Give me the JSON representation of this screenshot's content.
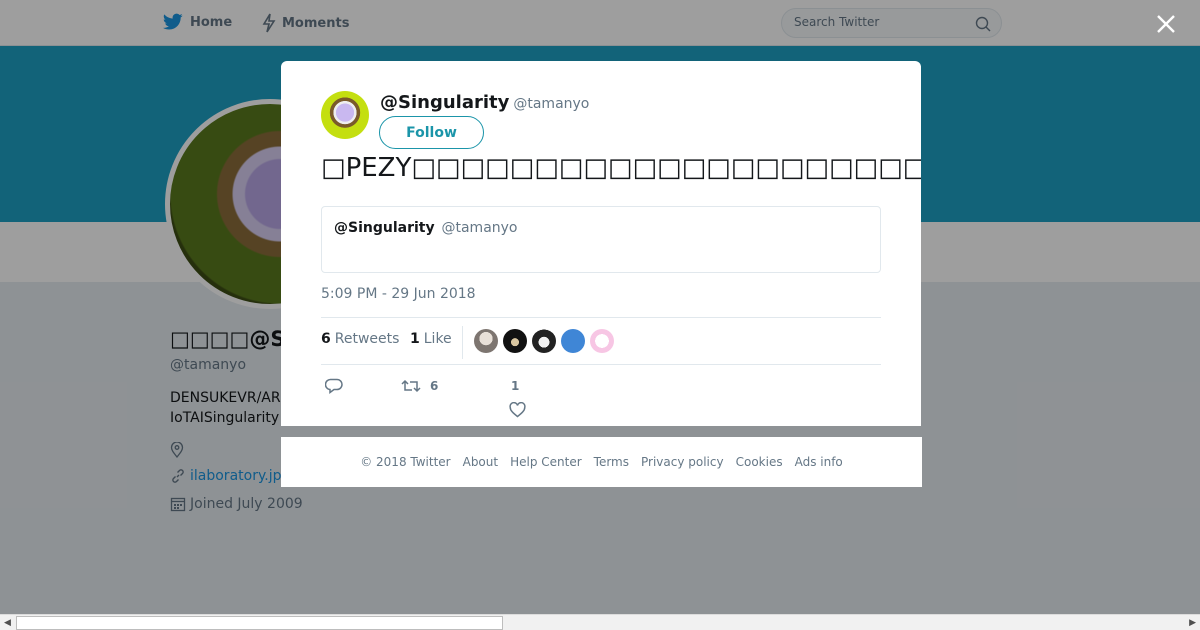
{
  "nav": {
    "home_label": "Home",
    "moments_label": "Moments",
    "search_placeholder": "Search Twitter"
  },
  "profile": {
    "name": "□□□□@Singularity",
    "handle": "@tamanyo",
    "bio": "DENSUKEVR/AR IoTAISingularity",
    "url": "ilaboratory.jp",
    "joined": "Joined July 2009"
  },
  "tweet": {
    "display_name": "@Singularity",
    "handle": "@tamanyo",
    "follow_label": "Follow",
    "text": "□PEZY□□□□□□□□□□□□□□□□□□□□□□□□□□□□□□□□□□□□□□□□□□□□□□□□□□□□",
    "quote_name": "@Singularity",
    "quote_handle": "@tamanyo",
    "timestamp": "5:09 PM - 29 Jun 2018",
    "retweets_count": "6",
    "retweets_label": "Retweets",
    "likes_count": "1",
    "likes_label": "Like",
    "action_retweet_count": "6",
    "action_like_count": "1"
  },
  "footer": {
    "copyright": "© 2018 Twitter",
    "links": [
      "About",
      "Help Center",
      "Terms",
      "Privacy policy",
      "Cookies",
      "Ads info"
    ]
  },
  "colors": {
    "banner": "#1da1c4",
    "accent": "#1b95e0",
    "follow": "#1b95a9"
  },
  "icons": [
    "twitter-bird-icon",
    "lightning-icon",
    "search-icon",
    "close-icon",
    "location-icon",
    "link-icon",
    "calendar-icon",
    "reply-icon",
    "retweet-icon",
    "heart-icon"
  ]
}
